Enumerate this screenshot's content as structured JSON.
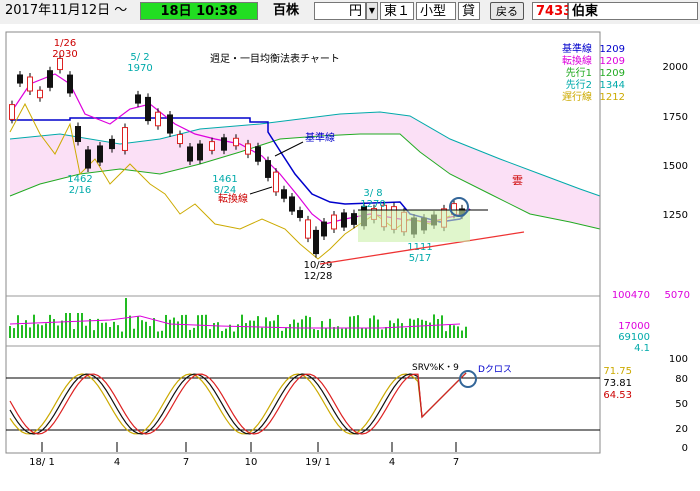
{
  "toolbar": {
    "date": "2017年11月12日 ～",
    "time": "18日 10:38",
    "scale": "百株",
    "currency": "円",
    "market": "東１",
    "size": "小型",
    "loan": "貸",
    "back_button": "戻る",
    "code": "7433",
    "company": "伯東"
  },
  "chart": {
    "title": "週足・一目均衡法表チャート",
    "legend": [
      {
        "name": "基準線",
        "value": "1209",
        "color": "#0000cc"
      },
      {
        "name": "転換線",
        "value": "1209",
        "color": "#dd00dd"
      },
      {
        "name": "先行1",
        "value": "1209",
        "color": "#22aa22"
      },
      {
        "name": "先行2",
        "value": "1344",
        "color": "#00aaaa"
      },
      {
        "name": "遅行線",
        "value": "1212",
        "color": "#ccaa00"
      }
    ],
    "price_ticks": [
      "2000",
      "1750",
      "1500",
      "1250"
    ],
    "annotations": {
      "high1_date": "1/26",
      "high1_val": "2030",
      "high2_date": "5/ 2",
      "high2_val": "1970",
      "low1_val": "1462",
      "low1_date": "2/16",
      "low2_val": "1461",
      "low2_date": "8/24",
      "low3_date": "10/29",
      "low3_val": "12/28",
      "mid_date": "3/ 8",
      "mid_val": "1270",
      "low4_val": "1111",
      "low4_date": "5/17",
      "kijun_label": "基準線",
      "tenkan_label": "転換線",
      "cloud_label": "雲"
    },
    "volume_labels": {
      "v1": "100470",
      "v1b": "5070",
      "v2": "17000",
      "v3": "69100",
      "v4": "4.1"
    },
    "osc_labels": {
      "name": "SRV%K・9",
      "cross": "Dクロス",
      "v1": "71.75",
      "v2": "73.81",
      "v3": "64.53"
    },
    "osc_ticks": [
      "100",
      "80",
      "50",
      "20",
      "0"
    ],
    "x_ticks": [
      "18/ 1",
      "4",
      "7",
      "10",
      "19/ 1",
      "4",
      "7"
    ],
    "colors": {
      "kijun": "#0000cc",
      "tenkan": "#dd00dd",
      "span1": "#22aa22",
      "span2": "#00aaaa",
      "chikou": "#ccaa00",
      "up": "#dd2222",
      "down": "#111111",
      "volume": "#22bb22",
      "accent_green": "#22dd22"
    }
  }
}
